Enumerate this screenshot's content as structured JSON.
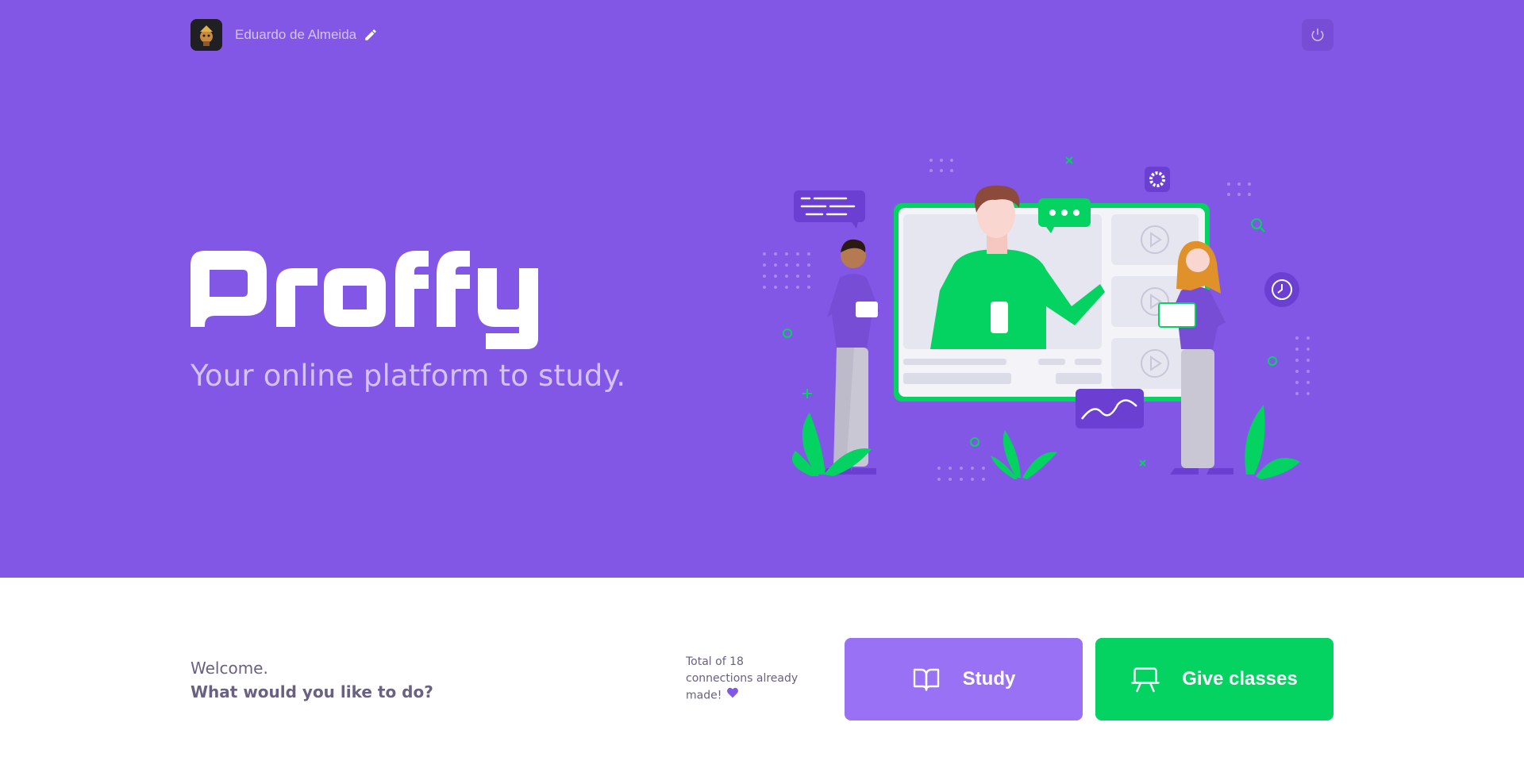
{
  "header": {
    "user_name": "Eduardo de Almeida",
    "icons": {
      "edit": "pencil-icon",
      "logout": "power-icon"
    }
  },
  "hero": {
    "logo_text": "Proffy",
    "tagline": "Your online platform to study."
  },
  "landing": {
    "welcome_line1": "Welcome.",
    "welcome_line2": "What would you like to do?",
    "connections_text": "Total of 18 connections already made!",
    "study_label": "Study",
    "give_classes_label": "Give classes"
  },
  "colors": {
    "primary": "#8257e5",
    "primary_lighter": "#9871f5",
    "secondary": "#04d361",
    "text_in_primary": "#d4c2ff",
    "text_base": "#6a6180"
  }
}
